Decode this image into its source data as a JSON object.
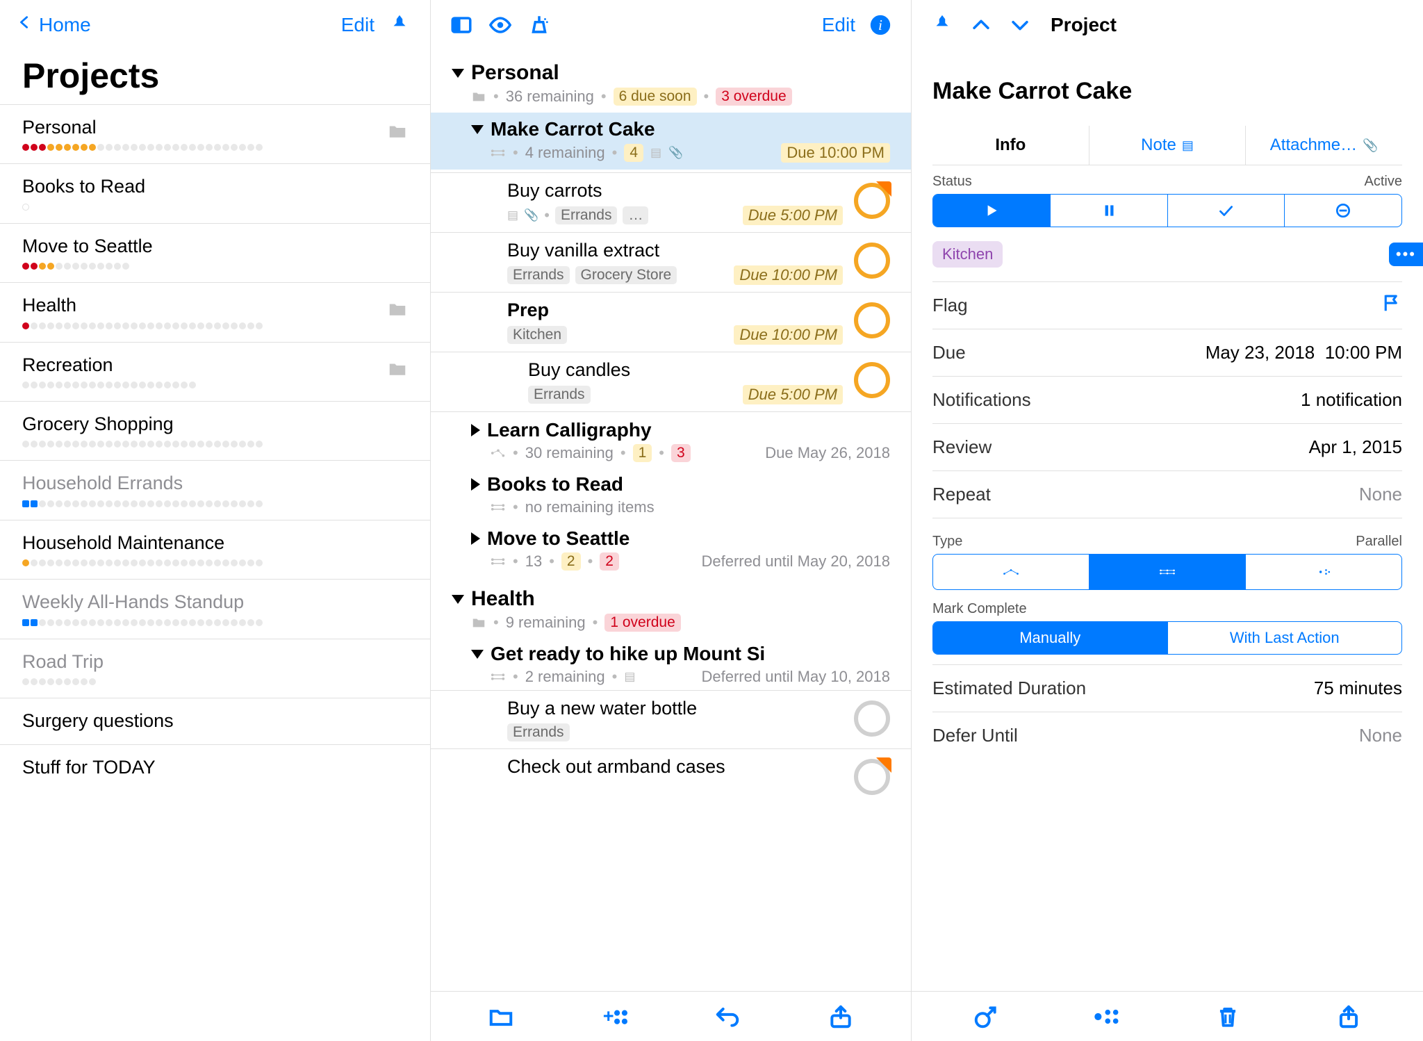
{
  "col1": {
    "back_label": "Home",
    "edit_label": "Edit",
    "heading": "Projects",
    "projects": {
      "p0": {
        "name": "Personal"
      },
      "p1": {
        "name": "Books to Read"
      },
      "p2": {
        "name": "Move to Seattle"
      },
      "p3": {
        "name": "Health"
      },
      "p4": {
        "name": "Recreation"
      },
      "p5": {
        "name": "Grocery Shopping"
      },
      "p6": {
        "name": "Household Errands"
      },
      "p7": {
        "name": "Household Maintenance"
      },
      "p8": {
        "name": "Weekly All-Hands Standup"
      },
      "p9": {
        "name": "Road Trip"
      },
      "p10": {
        "name": "Surgery questions"
      },
      "p11": {
        "name": "Stuff for TODAY"
      }
    }
  },
  "col2": {
    "edit_label": "Edit",
    "sections": {
      "personal": {
        "title": "Personal",
        "remaining": "36 remaining",
        "due_soon": "6 due soon",
        "overdue": "3 overdue"
      },
      "health": {
        "title": "Health",
        "remaining": "9 remaining",
        "overdue": "1 overdue"
      }
    },
    "projects": {
      "carrot": {
        "title": "Make Carrot Cake",
        "remaining": "4 remaining",
        "count": "4",
        "due": "Due 10:00 PM"
      },
      "callig": {
        "title": "Learn Calligraphy",
        "remaining": "30 remaining",
        "n1": "1",
        "n2": "3",
        "due": "Due May 26, 2018"
      },
      "books": {
        "title": "Books to Read",
        "remaining": "no remaining items"
      },
      "seattle": {
        "title": "Move to Seattle",
        "remaining": "13",
        "n1": "2",
        "n2": "2",
        "defer": "Deferred until May 20, 2018"
      },
      "mountsi": {
        "title": "Get ready to hike up Mount Si",
        "remaining": "2 remaining",
        "defer": "Deferred until May 10, 2018"
      }
    },
    "tasks": {
      "t0": {
        "title": "Buy carrots",
        "tag1": "Errands",
        "tag2": "…",
        "due": "Due 5:00 PM"
      },
      "t1": {
        "title": "Buy vanilla extract",
        "tag1": "Errands",
        "tag2": "Grocery Store",
        "due": "Due 10:00 PM"
      },
      "t2": {
        "title": "Prep",
        "tag1": "Kitchen",
        "due": "Due 10:00 PM"
      },
      "t3": {
        "title": "Buy candles",
        "tag1": "Errands",
        "due": "Due 5:00 PM"
      },
      "t4": {
        "title": "Buy a new water bottle",
        "tag1": "Errands"
      },
      "t5": {
        "title": "Check out armband cases"
      }
    }
  },
  "col3": {
    "header": "Project",
    "title": "Make Carrot Cake",
    "tabs": {
      "info": "Info",
      "note": "Note",
      "attach": "Attachme…"
    },
    "labels": {
      "status": "Status",
      "status_val": "Active",
      "tag": "Kitchen",
      "flag": "Flag",
      "due": "Due",
      "notifications": "Notifications",
      "review": "Review",
      "repeat": "Repeat",
      "type": "Type",
      "type_val": "Parallel",
      "mark_complete": "Mark Complete",
      "manually": "Manually",
      "with_last": "With Last Action",
      "est_dur": "Estimated Duration",
      "defer": "Defer Until"
    },
    "values": {
      "due_date": "May 23, 2018",
      "due_time": "10:00 PM",
      "notifications": "1 notification",
      "review": "Apr 1, 2015",
      "repeat": "None",
      "est_dur": "75 minutes",
      "defer": "None"
    }
  }
}
